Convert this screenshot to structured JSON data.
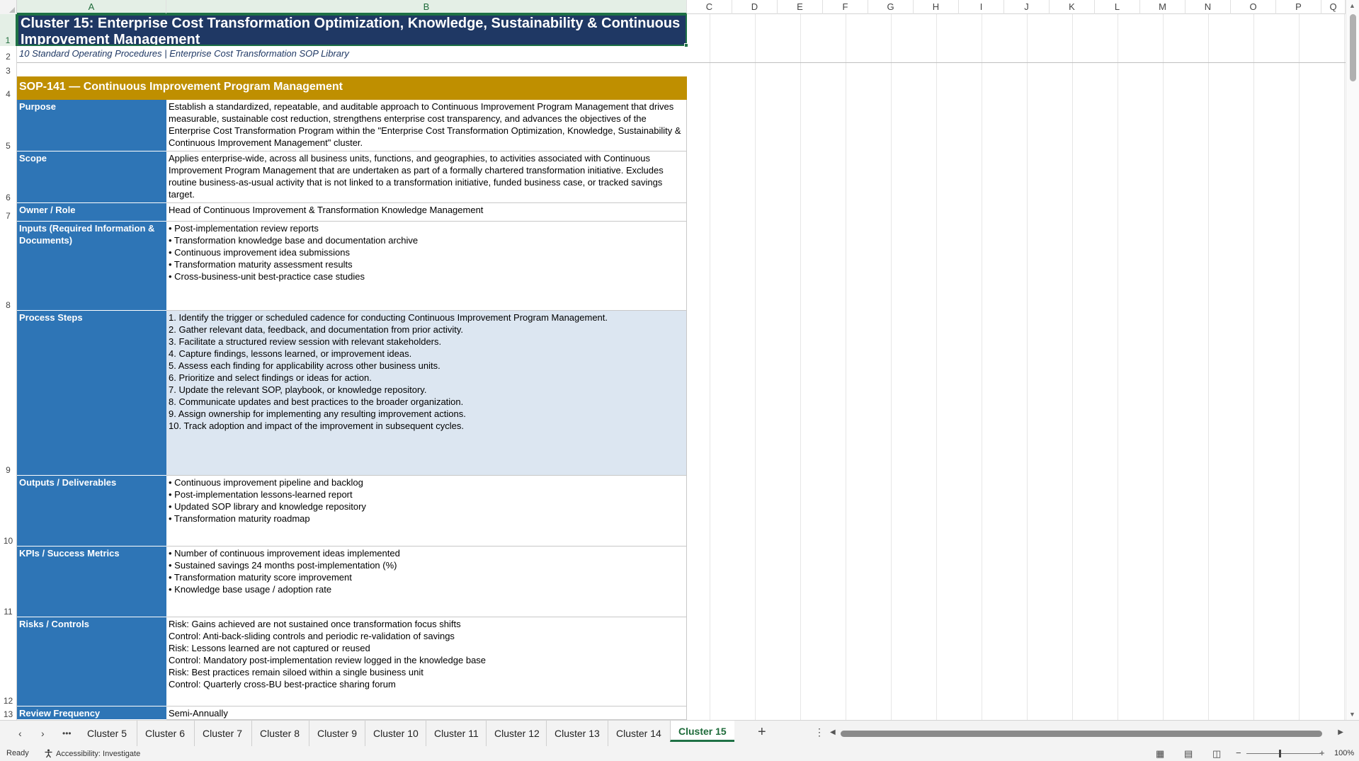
{
  "columns": [
    "A",
    "B",
    "C",
    "D",
    "E",
    "F",
    "G",
    "H",
    "I",
    "J",
    "K",
    "L",
    "M",
    "N",
    "O",
    "P",
    "Q"
  ],
  "rows": [
    "1",
    "2",
    "3",
    "4",
    "5",
    "6",
    "7",
    "8",
    "9",
    "10",
    "11",
    "12",
    "13"
  ],
  "sheet": {
    "title": "Cluster 15: Enterprise Cost Transformation Optimization, Knowledge, Sustainability & Continuous Improvement Management",
    "subtitle": "10 Standard Operating Procedures  |  Enterprise Cost Transformation SOP Library",
    "sop_header": "SOP-141  —  Continuous Improvement Program Management",
    "fields": [
      {
        "label": "Purpose",
        "value": "Establish a standardized, repeatable, and auditable approach to Continuous Improvement Program Management that drives measurable, sustainable cost reduction, strengthens enterprise cost transparency, and advances the objectives of the Enterprise Cost Transformation Program within the \"Enterprise Cost Transformation Optimization, Knowledge, Sustainability & Continuous Improvement Management\" cluster."
      },
      {
        "label": "Scope",
        "value": "Applies enterprise-wide, across all business units, functions, and geographies, to activities associated with Continuous Improvement Program Management that are undertaken as part of a formally chartered transformation initiative. Excludes routine business-as-usual activity that is not linked to a transformation initiative, funded business case, or tracked savings target."
      },
      {
        "label": "Owner / Role",
        "value": "Head of Continuous Improvement & Transformation Knowledge Management"
      },
      {
        "label": "Inputs (Required Information & Documents)",
        "value": "• Post-implementation review reports\n• Transformation knowledge base and documentation archive\n• Continuous improvement idea submissions\n• Transformation maturity assessment results\n• Cross-business-unit best-practice case studies"
      },
      {
        "label": "Process Steps",
        "value": "1. Identify the trigger or scheduled cadence for conducting Continuous Improvement Program Management.\n2. Gather relevant data, feedback, and documentation from prior activity.\n3. Facilitate a structured review session with relevant stakeholders.\n4. Capture findings, lessons learned, or improvement ideas.\n5. Assess each finding for applicability across other business units.\n6. Prioritize and select findings or ideas for action.\n7. Update the relevant SOP, playbook, or knowledge repository.\n8. Communicate updates and best practices to the broader organization.\n9. Assign ownership for implementing any resulting improvement actions.\n10. Track adoption and impact of the improvement in subsequent cycles."
      },
      {
        "label": "Outputs / Deliverables",
        "value": "• Continuous improvement pipeline and backlog\n• Post-implementation lessons-learned report\n• Updated SOP library and knowledge repository\n• Transformation maturity roadmap"
      },
      {
        "label": "KPIs / Success Metrics",
        "value": "• Number of continuous improvement ideas implemented\n• Sustained savings 24 months post-implementation (%)\n• Transformation maturity score improvement\n• Knowledge base usage / adoption rate"
      },
      {
        "label": "Risks / Controls",
        "value": "Risk: Gains achieved are not sustained once transformation focus shifts\nControl: Anti-back-sliding controls and periodic re-validation of savings\nRisk: Lessons learned are not captured or reused\nControl: Mandatory post-implementation review logged in the knowledge base\nRisk: Best practices remain siloed within a single business unit\nControl: Quarterly cross-BU best-practice sharing forum"
      },
      {
        "label": "Review Frequency",
        "value": "Semi-Annually"
      }
    ]
  },
  "tabs": {
    "more": "•••",
    "sheets": [
      "Cluster 5",
      "Cluster 6",
      "Cluster 7",
      "Cluster 8",
      "Cluster 9",
      "Cluster 10",
      "Cluster 11",
      "Cluster 12",
      "Cluster 13",
      "Cluster 14",
      "Cluster 15"
    ],
    "active": "Cluster 15"
  },
  "status": {
    "ready": "Ready",
    "accessibility": "Accessibility: Investigate",
    "zoom": "100%"
  },
  "colors": {
    "title_bg": "#1f3864",
    "sop_header_bg": "#bf8f00",
    "label_bg": "#2e75b6",
    "process_bg": "#dce6f1",
    "accent": "#1e7145"
  }
}
